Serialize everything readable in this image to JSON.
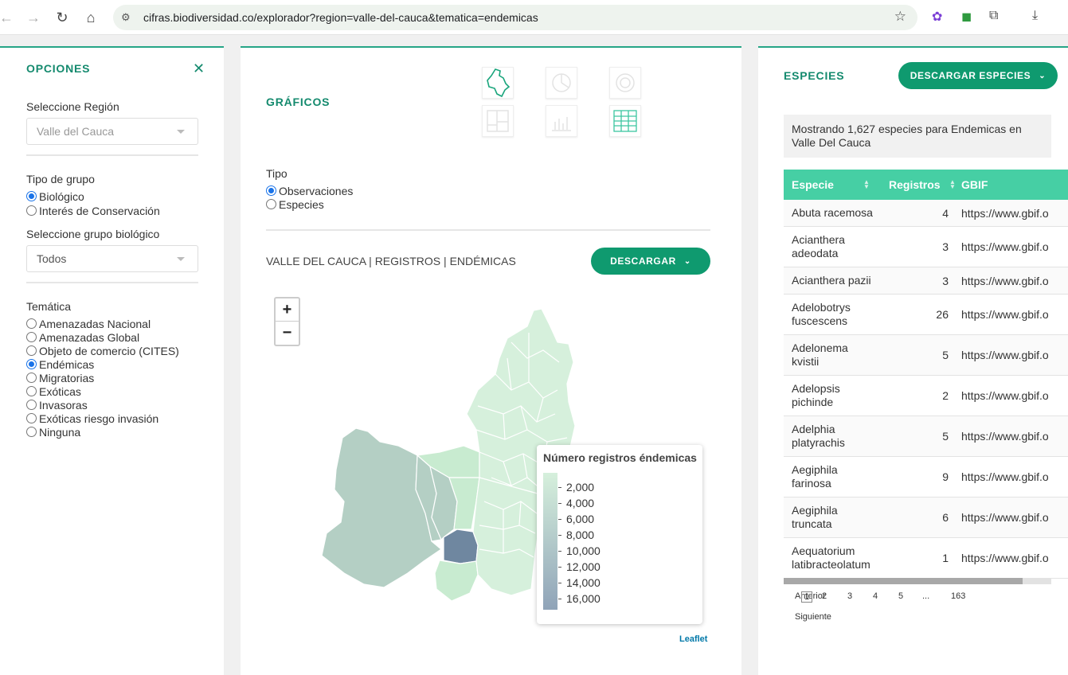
{
  "browser": {
    "url": "cifras.biodiversidad.co/explorador?region=valle-del-cauca&tematica=endemicas",
    "back_icon": "back-arrow-icon",
    "forward_icon": "forward-arrow-icon",
    "reload_icon": "reload-icon",
    "home_icon": "home-icon"
  },
  "left": {
    "title": "OPCIONES",
    "close": "✕",
    "region_label": "Seleccione Región",
    "region_value": "Valle del Cauca",
    "group_type_label": "Tipo de grupo",
    "group_types": [
      {
        "label": "Biológico",
        "checked": true
      },
      {
        "label": "Interés de Conservación",
        "checked": false
      }
    ],
    "bio_group_label": "Seleccione grupo biológico",
    "bio_group_value": "Todos",
    "theme_label": "Temática",
    "themes": [
      {
        "label": "Amenazadas Nacional",
        "checked": false
      },
      {
        "label": "Amenazadas Global",
        "checked": false
      },
      {
        "label": "Objeto de comercio (CITES)",
        "checked": false
      },
      {
        "label": "Endémicas",
        "checked": true
      },
      {
        "label": "Migratorias",
        "checked": false
      },
      {
        "label": "Exóticas",
        "checked": false
      },
      {
        "label": "Invasoras",
        "checked": false
      },
      {
        "label": "Exóticas riesgo invasión",
        "checked": false
      },
      {
        "label": "Ninguna",
        "checked": false
      }
    ]
  },
  "center": {
    "title": "GRÁFICOS",
    "type_label": "Tipo",
    "types": [
      {
        "label": "Observaciones",
        "checked": true
      },
      {
        "label": "Especies",
        "checked": false
      }
    ],
    "map_title": "VALLE DEL CAUCA | REGISTROS | ENDÉMICAS",
    "download_label": "DESCARGAR",
    "zoom_in": "+",
    "zoom_out": "−",
    "legend_title": "Número registros éndemicas",
    "legend_ticks": [
      "2,000",
      "4,000",
      "6,000",
      "8,000",
      "10,000",
      "12,000",
      "14,000",
      "16,000"
    ],
    "attribution": "Leaflet",
    "colors": {
      "low": "#d6f0dc",
      "mid": "#b6d2c6",
      "high": "#6f87a0",
      "accent": "#0f9a6f"
    }
  },
  "right": {
    "title": "ESPECIES",
    "download_label": "DESCARGAR ESPECIES",
    "info": "Mostrando 1,627 especies para Endemicas en Valle Del Cauca",
    "columns": [
      "Especie",
      "Registros",
      "GBIF"
    ],
    "rows": [
      {
        "name": "Abuta racemosa",
        "count": "4",
        "gbif": "https://www.gbif.o"
      },
      {
        "name": "Acianthera adeodata",
        "count": "3",
        "gbif": "https://www.gbif.o"
      },
      {
        "name": "Acianthera pazii",
        "count": "3",
        "gbif": "https://www.gbif.o"
      },
      {
        "name": "Adelobotrys fuscescens",
        "count": "26",
        "gbif": "https://www.gbif.o"
      },
      {
        "name": "Adelonema kvistii",
        "count": "5",
        "gbif": "https://www.gbif.o"
      },
      {
        "name": "Adelopsis pichinde",
        "count": "2",
        "gbif": "https://www.gbif.o"
      },
      {
        "name": "Adelphia platyrachis",
        "count": "5",
        "gbif": "https://www.gbif.o"
      },
      {
        "name": "Aegiphila farinosa",
        "count": "9",
        "gbif": "https://www.gbif.o"
      },
      {
        "name": "Aegiphila truncata",
        "count": "6",
        "gbif": "https://www.gbif.o"
      },
      {
        "name": "Aequatorium latibracteolatum",
        "count": "1",
        "gbif": "https://www.gbif.o"
      }
    ],
    "pager": {
      "prev": "Anterior",
      "pages": [
        "1",
        "2",
        "3",
        "4",
        "5",
        "...",
        "163"
      ],
      "next": "Siguiente"
    }
  }
}
